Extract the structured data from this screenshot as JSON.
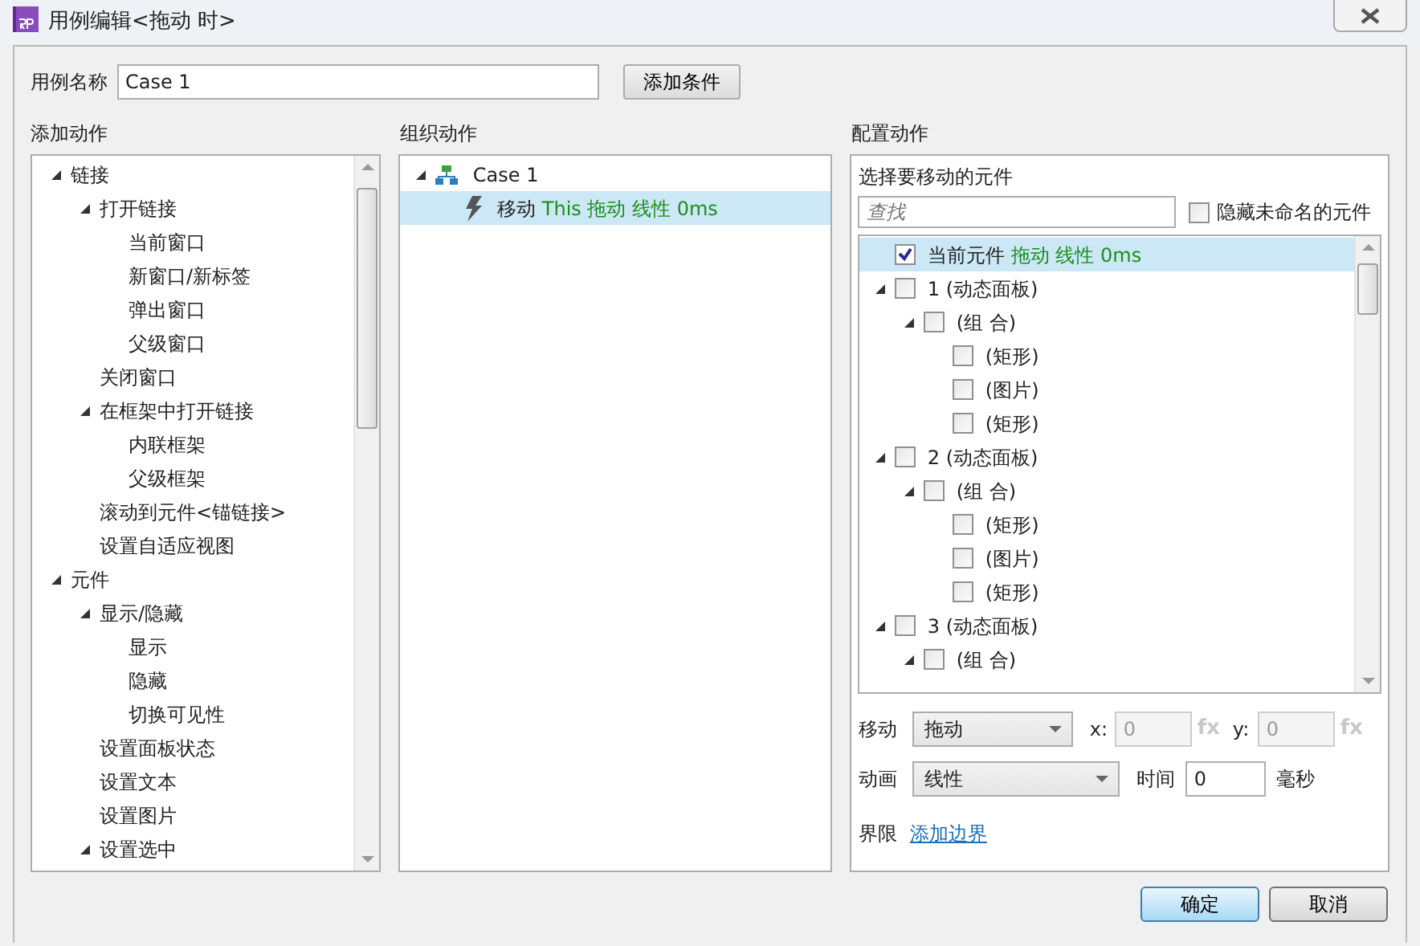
{
  "window": {
    "title": "用例编辑<拖动 时>"
  },
  "case_name": {
    "label": "用例名称",
    "value": "Case 1"
  },
  "add_condition_button": "添加条件",
  "add_actions": {
    "heading": "添加动作",
    "tree": [
      {
        "label": "链接",
        "expanded": true,
        "children": [
          {
            "label": "打开链接",
            "expanded": true,
            "children": [
              {
                "label": "当前窗口"
              },
              {
                "label": "新窗口/新标签"
              },
              {
                "label": "弹出窗口"
              },
              {
                "label": "父级窗口"
              }
            ]
          },
          {
            "label": "关闭窗口"
          },
          {
            "label": "在框架中打开链接",
            "expanded": true,
            "children": [
              {
                "label": "内联框架"
              },
              {
                "label": "父级框架"
              }
            ]
          },
          {
            "label": "滚动到元件<锚链接>"
          },
          {
            "label": "设置自适应视图"
          }
        ]
      },
      {
        "label": "元件",
        "expanded": true,
        "children": [
          {
            "label": "显示/隐藏",
            "expanded": true,
            "children": [
              {
                "label": "显示"
              },
              {
                "label": "隐藏"
              },
              {
                "label": "切换可见性"
              }
            ]
          },
          {
            "label": "设置面板状态"
          },
          {
            "label": "设置文本"
          },
          {
            "label": "设置图片"
          },
          {
            "label": "设置选中",
            "expanded": true
          }
        ]
      }
    ]
  },
  "organize_actions": {
    "heading": "组织动作",
    "case": {
      "label": "Case 1",
      "expanded": true
    },
    "actions": [
      {
        "verb": "移动",
        "detail": "This 拖动 线性 0ms",
        "selected": true
      }
    ]
  },
  "configure_action": {
    "heading": "配置动作",
    "subheading": "选择要移动的元件",
    "search": {
      "placeholder": "查找"
    },
    "hide_unnamed": {
      "label": "隐藏未命名的元件",
      "checked": false
    },
    "widgets": [
      {
        "label": "当前元件",
        "detail": "拖动 线性 0ms",
        "checked": true,
        "selected": true
      },
      {
        "label": "1 (动态面板)",
        "checked": false,
        "selected": false,
        "expanded": true,
        "children": [
          {
            "label": "(组 合)",
            "checked": false,
            "selected": false,
            "expanded": true,
            "children": [
              {
                "label": "(矩形)",
                "checked": false,
                "selected": false
              },
              {
                "label": "(图片)",
                "checked": false,
                "selected": false
              },
              {
                "label": "(矩形)",
                "checked": false,
                "selected": false
              }
            ]
          }
        ]
      },
      {
        "label": "2 (动态面板)",
        "checked": false,
        "selected": false,
        "expanded": true,
        "children": [
          {
            "label": "(组 合)",
            "checked": false,
            "selected": false,
            "expanded": true,
            "children": [
              {
                "label": "(矩形)",
                "checked": false,
                "selected": false
              },
              {
                "label": "(图片)",
                "checked": false,
                "selected": false
              },
              {
                "label": "(矩形)",
                "checked": false,
                "selected": false
              }
            ]
          }
        ]
      },
      {
        "label": "3 (动态面板)",
        "checked": false,
        "selected": false,
        "expanded": true,
        "children": [
          {
            "label": "(组 合)",
            "checked": false,
            "selected": false,
            "expanded": true
          }
        ]
      }
    ],
    "move": {
      "label": "移动",
      "value": "拖动",
      "x_label": "x:",
      "x_value": "0",
      "x_fx": "fx",
      "y_label": "y:",
      "y_value": "0",
      "y_fx": "fx",
      "coords_disabled": true
    },
    "animation": {
      "label": "动画",
      "value": "线性",
      "time_label": "时间",
      "time_value": "0",
      "unit": "毫秒"
    },
    "bounds": {
      "label": "界限",
      "link": "添加边界"
    }
  },
  "buttons": [
    {
      "label": "确定",
      "primary": true
    },
    {
      "label": "取消",
      "primary": false
    }
  ]
}
